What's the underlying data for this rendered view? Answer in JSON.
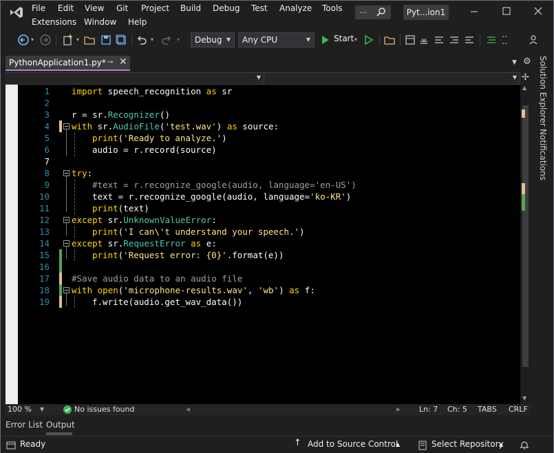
{
  "menu": {
    "items": [
      "File",
      "Edit",
      "View",
      "Git",
      "Project",
      "Build",
      "Debug",
      "Test",
      "Analyze",
      "Tools",
      "Extensions",
      "Window",
      "Help"
    ]
  },
  "titlebar": {
    "search_dots": "…",
    "project_badge": "Pyt...ion1"
  },
  "toolbar": {
    "config": "Debug",
    "platform": "Any CPU",
    "start_label": "Start"
  },
  "tab": {
    "name": "PythonApplication1.py*",
    "pin": "⊸",
    "close": "✕"
  },
  "editor": {
    "lines": [
      {
        "n": "1"
      },
      {
        "n": "2"
      },
      {
        "n": "3"
      },
      {
        "n": "4"
      },
      {
        "n": "5"
      },
      {
        "n": "6"
      },
      {
        "n": "7"
      },
      {
        "n": "8"
      },
      {
        "n": "9"
      },
      {
        "n": "10"
      },
      {
        "n": "11"
      },
      {
        "n": "12"
      },
      {
        "n": "13"
      },
      {
        "n": "14"
      },
      {
        "n": "15"
      },
      {
        "n": "16"
      },
      {
        "n": "17"
      },
      {
        "n": "18"
      },
      {
        "n": "19"
      }
    ],
    "code": {
      "l1a": "import",
      "l1b": " speech_recognition ",
      "l1c": "as",
      "l1d": " sr",
      "l3a": "r = sr.",
      "l3b": "Recognizer",
      "l3c": "()",
      "l4a": "with",
      "l4b": " sr.",
      "l4c": "AudioFile",
      "l4d": "(",
      "l4e": "'test.wav'",
      "l4f": ") ",
      "l4g": "as",
      "l4h": " source:",
      "l5a": "print",
      "l5b": "(",
      "l5c": "'Ready to analyze.'",
      "l5d": ")",
      "l6a": "audio = r.record(source)",
      "l8a": "try",
      "l8b": ":",
      "l9a": "#text = r.recognize_google(audio, language='en-US')",
      "l10a": "text = r.recognize_google(audio, language=",
      "l10b": "'ko-KR'",
      "l10c": ")",
      "l11a": "print",
      "l11b": "(text)",
      "l12a": "except",
      "l12b": " sr.",
      "l12c": "UnknownValueError",
      "l12d": ":",
      "l13a": "print",
      "l13b": "(",
      "l13c": "'I can\\'t understand your speech.'",
      "l13d": ")",
      "l14a": "except",
      "l14b": " sr.",
      "l14c": "RequestError",
      "l14d": " ",
      "l14e": "as",
      "l14f": " e:",
      "l15a": "print",
      "l15b": "(",
      "l15c": "'Request error: {0}'",
      "l15d": ".format(e))",
      "l17a": "#Save audio data to an audio file",
      "l18a": "with",
      "l18b": " ",
      "l18c": "open",
      "l18d": "(",
      "l18e": "'microphone-results.wav'",
      "l18f": ", ",
      "l18g": "'wb'",
      "l18h": ") ",
      "l18i": "as",
      "l18j": " f:",
      "l19a": "f.write(audio.get_wav_data())"
    }
  },
  "side": {
    "solution_explorer": "Solution Explorer",
    "notifications": "Notifications"
  },
  "edstatus": {
    "zoom": "100 %",
    "issues": "No issues found",
    "ln": "Ln: 7",
    "ch": "Ch: 5",
    "tabs": "TABS",
    "crlf": "CRLF"
  },
  "bottom": {
    "error_list": "Error List",
    "output": "Output"
  },
  "status": {
    "ready": "Ready",
    "source_control": "Add to Source Control",
    "repository": "Select Repository"
  },
  "colors": {
    "accent": "#b180d7",
    "change_saved": "#57a64a",
    "change_unsaved": "#e2c08d"
  }
}
